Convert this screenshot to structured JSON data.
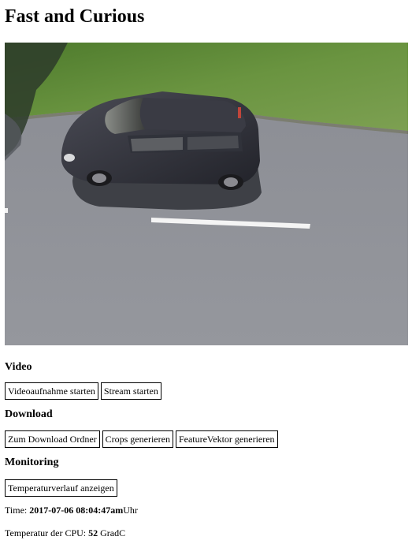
{
  "page": {
    "title": "Fast and Curious"
  },
  "camera": {
    "icon": "camera-feed-image"
  },
  "video": {
    "heading": "Video",
    "record_label": "Videoaufnahme starten",
    "stream_label": "Stream starten"
  },
  "download": {
    "heading": "Download",
    "folder_label": "Zum Download Ordner",
    "crops_label": "Crops generieren",
    "feature_label": "FeatureVektor generieren"
  },
  "monitoring": {
    "heading": "Monitoring",
    "temp_history_label": "Temperaturverlauf anzeigen",
    "time_prefix": "Time: ",
    "time_value": "2017-07-06 08:04:47am",
    "time_suffix": "Uhr",
    "cpu_prefix": "Temperatur der CPU: ",
    "cpu_value": "52",
    "cpu_suffix": " GradC"
  },
  "colors": {
    "grass": "#5e8a3a",
    "asphalt": "#8e9096",
    "car_body": "#2b2b30",
    "lane_marking": "#f4f4f4"
  }
}
